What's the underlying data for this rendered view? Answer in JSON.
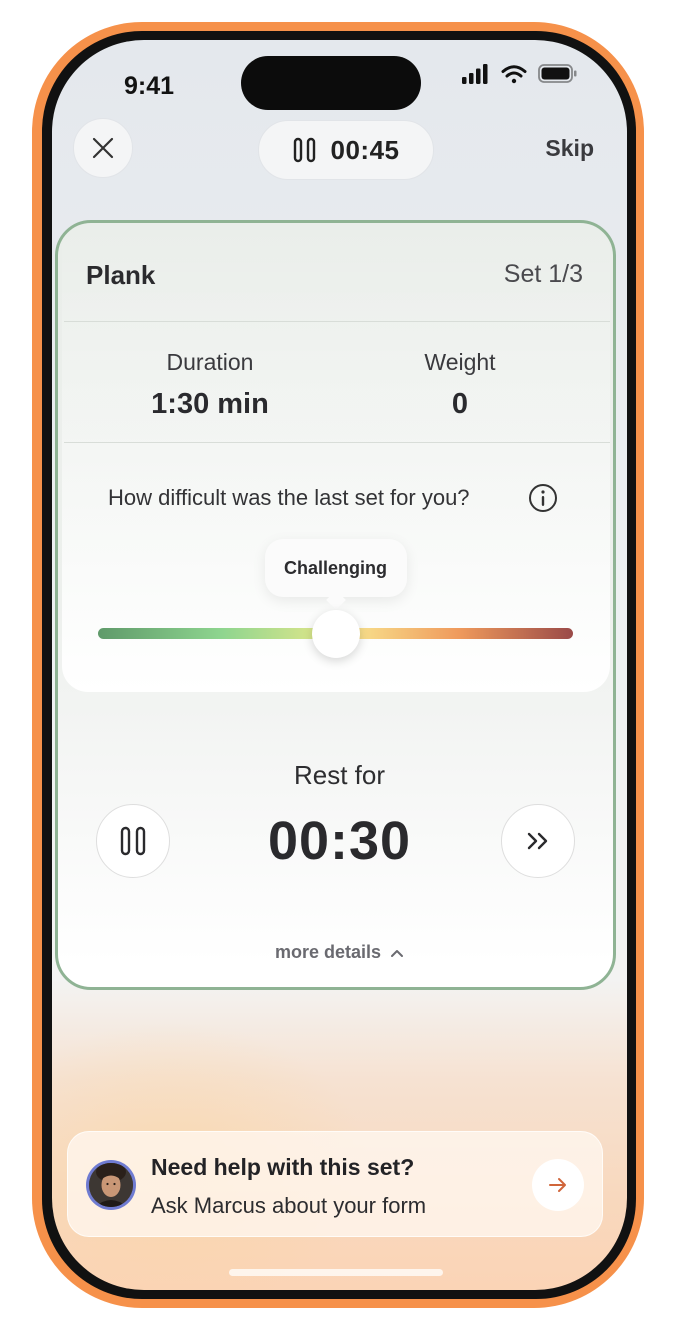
{
  "status_bar": {
    "time": "9:41",
    "icons": [
      "signal-icon",
      "wifi-icon",
      "battery-icon"
    ]
  },
  "top_bar": {
    "close_icon": "close-icon",
    "timer": "00:45",
    "timer_icon": "pause-icon",
    "skip_label": "Skip"
  },
  "exercise": {
    "name": "Plank",
    "set_label": "Set 1/3",
    "stats": [
      {
        "label": "Duration",
        "value": "1:30 min"
      },
      {
        "label": "Weight",
        "value": "0"
      }
    ]
  },
  "difficulty": {
    "question": "How difficult was the last set for you?",
    "selected": "Challenging",
    "slider_value": 0.5,
    "gradient_colors": [
      "#5f9a6a",
      "#8ed58f",
      "#d8e58a",
      "#f7da88",
      "#ef9a5c",
      "#9a4a48"
    ]
  },
  "rest": {
    "label": "Rest for",
    "time": "00:30",
    "pause_icon": "pause-icon",
    "forward_icon": "fast-forward-icon",
    "more_details": "more details"
  },
  "help": {
    "title": "Need help with this set?",
    "subtitle": "Ask Marcus about your form",
    "arrow_icon": "arrow-right-icon"
  },
  "colors": {
    "device_frame": "#f6914a",
    "card_border": "#8fb394",
    "arrow_accent": "#d0653a"
  }
}
